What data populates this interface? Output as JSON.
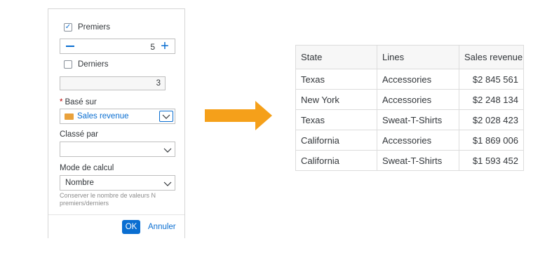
{
  "panel": {
    "premiers": {
      "label": "Premiers",
      "checked": true
    },
    "premiers_stepper": {
      "value": "5"
    },
    "derniers": {
      "label": "Derniers",
      "checked": false
    },
    "derniers_value": "3",
    "base_sur": {
      "label": "Basé sur",
      "value": "Sales revenue",
      "icon": "dimension-icon"
    },
    "classe_par": {
      "label": "Classé par",
      "value": ""
    },
    "mode_calcul": {
      "label": "Mode de calcul",
      "value": "Nombre"
    },
    "hint": "Conserver le nombre de valeurs N premiers/derniers",
    "ok_label": "OK",
    "cancel_label": "Annuler"
  },
  "arrow": {
    "color": "#f5a01a"
  },
  "table": {
    "headers": [
      "State",
      "Lines",
      "Sales revenue"
    ],
    "rows": [
      [
        "Texas",
        "Accessories",
        "$2 845 561"
      ],
      [
        "New York",
        "Accessories",
        "$2 248 134"
      ],
      [
        "Texas",
        "Sweat-T-Shirts",
        "$2 028 423"
      ],
      [
        "California",
        "Accessories",
        "$1 869 006"
      ],
      [
        "California",
        "Sweat-T-Shirts",
        "$1 593 452"
      ]
    ]
  },
  "colors": {
    "accent": "#0a6ed1",
    "required": "#bb0000"
  }
}
